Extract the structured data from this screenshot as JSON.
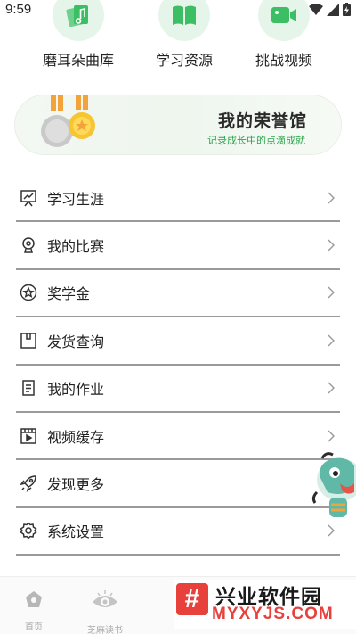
{
  "status": {
    "time": "9:59"
  },
  "quick_actions": [
    {
      "label": "磨耳朵曲库",
      "icon": "music-cards-icon"
    },
    {
      "label": "学习资源",
      "icon": "book-icon"
    },
    {
      "label": "挑战视频",
      "icon": "video-camera-icon"
    }
  ],
  "banner": {
    "title": "我的荣誉馆",
    "subtitle": "记录成长中的点滴成就"
  },
  "menu": [
    {
      "label": "学习生涯",
      "icon": "presentation-chart-icon"
    },
    {
      "label": "我的比赛",
      "icon": "trophy-icon"
    },
    {
      "label": "奖学金",
      "icon": "star-badge-icon"
    },
    {
      "label": "发货查询",
      "icon": "package-icon"
    },
    {
      "label": "我的作业",
      "icon": "document-icon"
    },
    {
      "label": "视频缓存",
      "icon": "film-icon"
    },
    {
      "label": "发现更多",
      "icon": "rocket-icon"
    },
    {
      "label": "系统设置",
      "icon": "gear-icon"
    }
  ],
  "tabbar": [
    {
      "label": "首页",
      "icon": "home-icon"
    },
    {
      "label": "芝麻读书",
      "icon": "eye-book-icon"
    }
  ],
  "watermark": {
    "cn": "兴业软件园",
    "en": "MYXYJS.COM",
    "logo_char": "#"
  },
  "colors": {
    "accent_green": "#2aa54a",
    "icon_green": "#3cbf64",
    "divider": "#9a9a9a"
  }
}
